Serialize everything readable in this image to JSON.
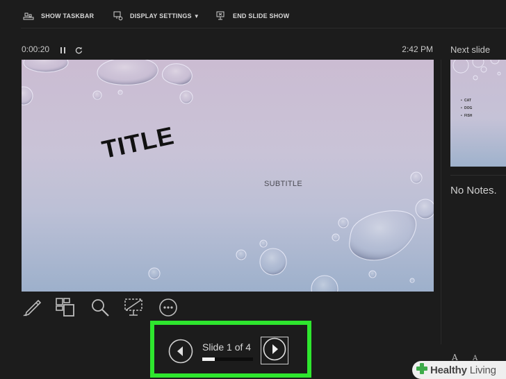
{
  "toolbar": {
    "show_taskbar": "SHOW TASKBAR",
    "display_settings": "DISPLAY SETTINGS",
    "end_slide_show": "END SLIDE SHOW"
  },
  "timer": {
    "elapsed": "0:00:20"
  },
  "clock": {
    "time": "2:42 PM"
  },
  "next_slide": {
    "label": "Next slide",
    "bullets": [
      "CAT",
      "DOG",
      "FISH"
    ]
  },
  "slide": {
    "title": "TITLE",
    "subtitle": "SUBTITLE"
  },
  "navigation": {
    "counter": "Slide 1 of 4",
    "current": 1,
    "total": 4,
    "progress": 0.25
  },
  "notes": {
    "text": "No Notes."
  },
  "font_controls": {
    "increase": "A",
    "decrease": "A"
  },
  "watermark": {
    "brand_bold": "Healthy",
    "brand_light": "Living"
  },
  "colors": {
    "highlight": "#2ee62e",
    "background": "#1c1c1c",
    "watermark_green": "#3dab4a"
  },
  "icons": [
    "taskbar-icon",
    "display-settings-icon",
    "end-show-icon",
    "pause-icon",
    "reset-icon",
    "pen-icon",
    "see-all-slides-icon",
    "zoom-icon",
    "black-screen-icon",
    "more-options-icon",
    "prev-arrow-icon",
    "next-arrow-icon"
  ]
}
